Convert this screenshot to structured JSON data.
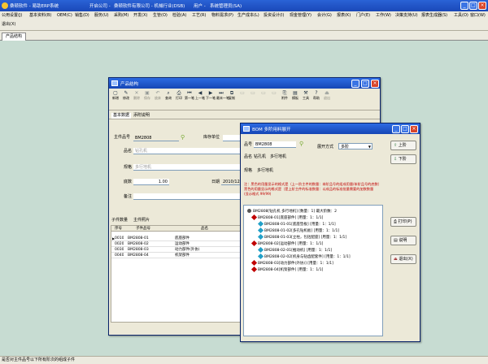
{
  "app": {
    "title": "桑顿软件 - 易助ERP系统",
    "company_label": "开启公司 -",
    "company": "桑顿软件有限公司 - 机械行业(DSB)",
    "user_label": "用户 -",
    "user": "系统管理员(SA)"
  },
  "menu": {
    "row1": [
      "公用设置(J)",
      "基本资料(B)",
      "OEM(C)",
      "销售(D)",
      "服务(U)",
      "采购(M)",
      "开发(X)",
      "生管(O)",
      "检验(A)",
      "工艺(R)",
      "物料需求(P)",
      "生产成本(L)",
      "投资设计(I)",
      "现金管理(Y)",
      "会计(G)",
      "报表(K)",
      "门户(E)",
      "工作(W)",
      "决策支持(U)",
      "报表生成器(S)",
      "工具(O)",
      "窗口(W)"
    ],
    "row2": [
      "退出(X)"
    ]
  },
  "tab": {
    "label": "产品结构"
  },
  "product_window": {
    "title": "产品结构",
    "toolbar": [
      "新增",
      "修改",
      "删除",
      "保存",
      "放弃",
      "查询",
      "打印",
      "第一笔",
      "上一笔",
      "下一笔",
      "最末一笔",
      "复制",
      "",
      "",
      "",
      "",
      "",
      "",
      "附件",
      "模板",
      "工具",
      "帮助",
      "退出"
    ],
    "tabs": [
      "基本数据",
      "添附说明"
    ],
    "main_part_label": "主件品号",
    "main_part_value": "BM2808",
    "warehouse_label": "库存单位",
    "name_label": "品名",
    "name_placeholder": "钻孔机",
    "spec_label": "规格",
    "spec_placeholder": "多行地机",
    "qty_label": "底数",
    "qty_value": "1.00",
    "date_label": "日期",
    "date_value": "2010/12/2",
    "remark_label": "备注",
    "sub_tabs": [
      "子件数量",
      "主件照片"
    ],
    "table_headers": [
      "序号",
      "子件品号",
      "品名"
    ],
    "rows": [
      {
        "seq": "0010",
        "code": "BM2808-01",
        "name": "底座部件"
      },
      {
        "seq": "0020",
        "code": "BM2808-02",
        "name": "运动部件"
      },
      {
        "seq": "0030",
        "code": "BM2808-03",
        "name": "动力部件(外协)"
      },
      {
        "seq": "0040",
        "code": "BM2808-04",
        "name": "机架部件"
      }
    ]
  },
  "bom_window": {
    "title": "BOM 多阶用料展开",
    "part_label": "品号",
    "part_value": "BM2808",
    "mode_label": "展开方式",
    "mode_value": "多阶",
    "name_label": "品名",
    "name_value": "钻孔机",
    "name_value2": "多行地机",
    "spec_label": "规格",
    "spec_value": "多行地机",
    "up_button": "上阶",
    "down_button": "下阶",
    "note_line1": "注：黑色的用量显示的格式是（上一阶主件的数量：本阶品号的组成用量/本阶品号的底数）",
    "note_line2": "黑色的用量显示的格式是（是上阶主件的标准数量：以成品的标准批量需要的加数数量",
    "note_line3": "(显示格式 99/99)",
    "tree": [
      {
        "level": 0,
        "color": "#555555",
        "text": "BM2808[钻孔机 多行地机] [数量：1] 最大阶数：2"
      },
      {
        "level": 1,
        "color": "#c00000",
        "text": "BM2808-01[底座部件] [用量：1：1/1]"
      },
      {
        "level": 2,
        "color": "#22a0c8",
        "text": "BM2808-01-01[底座垫板] [用量：1：1/1]"
      },
      {
        "level": 2,
        "color": "#22a0c8",
        "text": "BM2808-01-02[多孔钻机板] [用量：1：1/1]"
      },
      {
        "level": 2,
        "color": "#22a0c8",
        "text": "BM2808-01-03[立柱，包括配座] [用量：1：1/1]"
      },
      {
        "level": 1,
        "color": "#c00000",
        "text": "BM2808-02[运动部件] [用量：1：1/1]"
      },
      {
        "level": 2,
        "color": "#22a0c8",
        "text": "BM2808-02-01[推动机] [用量：1：1/1]"
      },
      {
        "level": 2,
        "color": "#22a0c8",
        "text": "BM2808-02-02[机身与钻齿配套件] [用量：1：1/1]"
      },
      {
        "level": 1,
        "color": "#c00000",
        "text": "BM2808-03[动力部件(外协)] [用量：1：1/1]"
      },
      {
        "level": 1,
        "color": "#c00000",
        "text": "BM2808-04[机架部件] [用量：1：1/1]"
      }
    ],
    "side_buttons": [
      "打印(P)",
      "说明",
      "退出(X)"
    ]
  },
  "status": {
    "text": "是否对主件品号以下所有阶次的组成子件"
  }
}
